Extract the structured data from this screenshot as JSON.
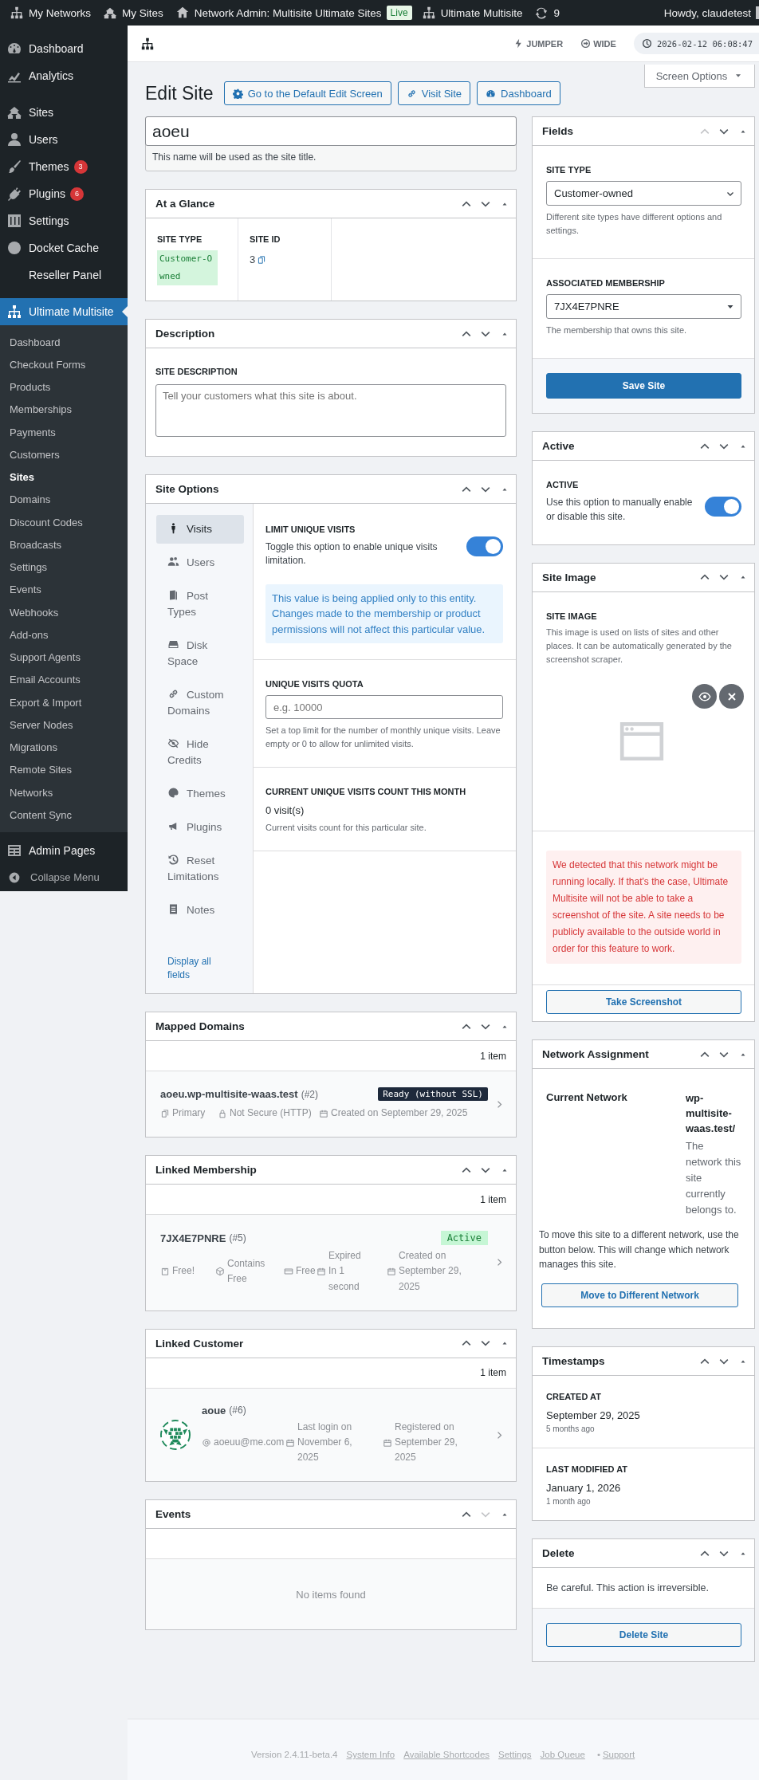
{
  "admin_bar": {
    "items": [
      {
        "label": "My Networks"
      },
      {
        "label": "My Sites"
      },
      {
        "label": "Network Admin: Multisite Ultimate Sites",
        "badge": "Live"
      },
      {
        "label": "Ultimate Multisite"
      },
      {
        "label": "9"
      }
    ],
    "greeting": "Howdy, claudetest"
  },
  "toolbar": {
    "links": [
      "JUMPER",
      "WIDE"
    ],
    "clock": "2026-02-12 06:08:47"
  },
  "screen_options": "Screen Options",
  "sidebar": {
    "groups": [
      {
        "items": [
          {
            "label": "Dashboard",
            "kind": "menu",
            "selected": false
          },
          {
            "label": "Analytics",
            "kind": "menu",
            "selected": false
          }
        ]
      },
      {
        "items": [
          {
            "label": "Sites",
            "kind": "menu",
            "selected": false
          },
          {
            "label": "Users",
            "kind": "menu",
            "selected": false
          },
          {
            "label": "Themes",
            "kind": "menu",
            "selected": false,
            "badge": "3"
          },
          {
            "label": "Plugins",
            "kind": "menu",
            "selected": false,
            "badge": "6"
          },
          {
            "label": "Settings",
            "kind": "menu",
            "selected": false
          },
          {
            "label": "Docket Cache",
            "kind": "menu",
            "selected": false
          },
          {
            "label": "Reseller Panel",
            "kind": "menu",
            "selected": false
          }
        ]
      },
      {
        "items": [
          {
            "label": "Ultimate Multisite",
            "kind": "menu",
            "selected": true,
            "children": [
              {
                "label": "Dashboard",
                "selected": false
              },
              {
                "label": "Checkout Forms",
                "selected": false
              },
              {
                "label": "Products",
                "selected": false
              },
              {
                "label": "Memberships",
                "selected": false
              },
              {
                "label": "Payments",
                "selected": false
              },
              {
                "label": "Customers",
                "selected": false
              },
              {
                "label": "Sites",
                "selected": true
              },
              {
                "label": "Domains",
                "selected": false
              },
              {
                "label": "Discount Codes",
                "selected": false
              },
              {
                "label": "Broadcasts",
                "selected": false
              },
              {
                "label": "Settings",
                "selected": false
              },
              {
                "label": "Events",
                "selected": false
              },
              {
                "label": "Webhooks",
                "selected": false
              },
              {
                "label": "Add-ons",
                "selected": false
              },
              {
                "label": "Support Agents",
                "selected": false
              },
              {
                "label": "Email Accounts",
                "selected": false
              },
              {
                "label": "Export & Import",
                "selected": false
              },
              {
                "label": "Server Nodes",
                "selected": false
              },
              {
                "label": "Migrations",
                "selected": false
              },
              {
                "label": "Remote Sites",
                "selected": false
              },
              {
                "label": "Networks",
                "selected": false
              },
              {
                "label": "Content Sync",
                "selected": false
              }
            ]
          }
        ]
      },
      {
        "items": [
          {
            "label": "Admin Pages",
            "kind": "menu",
            "selected": false
          },
          {
            "label": "Collapse Menu",
            "kind": "collapse",
            "selected": false
          }
        ]
      }
    ]
  },
  "page": {
    "title": "Edit Site",
    "actions": [
      "Go to the Default Edit Screen",
      "Visit Site",
      "Dashboard"
    ]
  },
  "site_name": {
    "value": "aoeu",
    "hint": "This name will be used as the site title."
  },
  "at_a_glance": {
    "title": "At a Glance",
    "fields": [
      {
        "label": "SITE TYPE",
        "value": "Customer-Owned",
        "kind": "tag"
      },
      {
        "label": "SITE ID",
        "value": "3",
        "kind": "copy"
      }
    ]
  },
  "description": {
    "title": "Description",
    "label": "SITE DESCRIPTION",
    "placeholder": "Tell your customers what this site is about."
  },
  "site_options": {
    "title": "Site Options",
    "tabs": [
      {
        "label": "Visits",
        "selected": true
      },
      {
        "label": "Users",
        "selected": false
      },
      {
        "label": "Post Types",
        "selected": false
      },
      {
        "label": "Disk Space",
        "selected": false
      },
      {
        "label": "Custom Domains",
        "selected": false
      },
      {
        "label": "Hide Credits",
        "selected": false
      },
      {
        "label": "Themes",
        "selected": false
      },
      {
        "label": "Plugins",
        "selected": false
      },
      {
        "label": "Reset Limitations",
        "selected": false
      },
      {
        "label": "Notes",
        "selected": false
      }
    ],
    "display_all": "Display all fields",
    "limit": {
      "label": "LIMIT UNIQUE VISITS",
      "description": "Toggle this option to enable unique visits limitation.",
      "on": true,
      "notice": "This value is being applied only to this entity. Changes made to the membership or product permissions will not affect this particular value."
    },
    "quota": {
      "label": "UNIQUE VISITS QUOTA",
      "placeholder": "e.g. 10000",
      "hint": "Set a top limit for the number of monthly unique visits. Leave empty or 0 to allow for unlimited visits."
    },
    "count": {
      "label": "CURRENT UNIQUE VISITS COUNT THIS MONTH",
      "value": "0 visit(s)",
      "hint": "Current visits count for this particular site."
    }
  },
  "mapped_domains": {
    "title": "Mapped Domains",
    "count": "1 item",
    "items": [
      {
        "domain": "aoeu.wp-multisite-waas.test",
        "id": "(#2)",
        "status": "Ready (without SSL)",
        "meta": [
          "Primary",
          "Not Secure (HTTP)",
          "Created on September 29, 2025"
        ]
      }
    ]
  },
  "linked_membership": {
    "title": "Linked Membership",
    "count": "1 item",
    "items": [
      {
        "code": "7JX4E7PNRE",
        "id": "(#5)",
        "status": "Active",
        "meta": [
          "Free!",
          "Contains Free",
          "Free",
          "Expired In 1 second",
          "Created on September 29, 2025"
        ]
      }
    ]
  },
  "linked_customer": {
    "title": "Linked Customer",
    "count": "1 item",
    "items": [
      {
        "name": "aoue",
        "id": "(#6)",
        "meta": [
          "aoeuu@me.com",
          "Last login on November 6, 2025",
          "Registered on September 29, 2025"
        ]
      }
    ]
  },
  "events": {
    "title": "Events",
    "down_disabled": true,
    "empty": "No items found"
  },
  "fields": {
    "title": "Fields",
    "up_disabled": true,
    "site_type": {
      "label": "SITE TYPE",
      "value": "Customer-owned",
      "hint": "Different site types have different options and settings."
    },
    "membership": {
      "label": "ASSOCIATED MEMBERSHIP",
      "value": "7JX4E7PNRE",
      "hint": "The membership that owns this site."
    },
    "save": "Save Site"
  },
  "active": {
    "title": "Active",
    "label": "ACTIVE",
    "description": "Use this option to manually enable or disable this site.",
    "on": true
  },
  "site_image": {
    "title": "Site Image",
    "label": "SITE IMAGE",
    "description": "This image is used on lists of sites and other places. It can be automatically generated by the screenshot scraper.",
    "warning": "We detected that this network might be running locally. If that's the case, Ultimate Multisite will not be able to take a screenshot of the site. A site needs to be publicly available to the outside world in order for this feature to work.",
    "button": "Take Screenshot"
  },
  "network_assignment": {
    "title": "Network Assignment",
    "label": "Current Network",
    "network": "wp-multisite-waas.test/",
    "network_hint": "The network this site currently belongs to.",
    "description": "To move this site to a different network, use the button below. This will change which network manages this site.",
    "button": "Move to Different Network"
  },
  "timestamps": {
    "title": "Timestamps",
    "items": [
      {
        "label": "CREATED AT",
        "value": "September 29, 2025",
        "ago": "5 months ago"
      },
      {
        "label": "LAST MODIFIED AT",
        "value": "January 1, 2026",
        "ago": "1 month ago"
      }
    ]
  },
  "delete": {
    "title": "Delete",
    "warning": "Be careful. This action is irreversible.",
    "button": "Delete Site"
  },
  "footer": {
    "version": "Version 2.4.11-beta.4",
    "links": [
      "System Info",
      "Available Shortcodes",
      "Settings",
      "Job Queue"
    ],
    "separator": "•",
    "last_link": "Support"
  }
}
